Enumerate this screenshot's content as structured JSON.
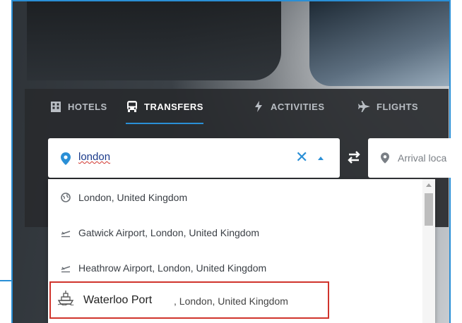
{
  "tabs": [
    {
      "label": "HOTELS",
      "icon": "building-icon",
      "active": false
    },
    {
      "label": "TRANSFERS",
      "icon": "bus-icon",
      "active": true
    },
    {
      "label": "ACTIVITIES",
      "icon": "bolt-icon",
      "active": false
    },
    {
      "label": "FLIGHTS",
      "icon": "plane-icon",
      "active": false
    }
  ],
  "search": {
    "value": "london",
    "clear_glyph": "✕",
    "icon": "location-pin-icon"
  },
  "arrival": {
    "placeholder": "Arrival loca",
    "icon": "location-pin-icon"
  },
  "dropdown": {
    "items": [
      {
        "label": "London, United Kingdom",
        "icon": "globe-icon"
      },
      {
        "label": "Gatwick Airport, London, United Kingdom",
        "icon": "airplane-takeoff-icon"
      },
      {
        "label": "Heathrow Airport, London, United Kingdom",
        "icon": "airplane-takeoff-icon"
      }
    ],
    "highlighted": {
      "name": "Waterloo Port",
      "rest": ", London, United Kingdom",
      "icon": "ship-icon"
    }
  },
  "colors": {
    "accent": "#2a8fd6",
    "highlight_border": "#d0342c",
    "panel": "#282a2e"
  }
}
